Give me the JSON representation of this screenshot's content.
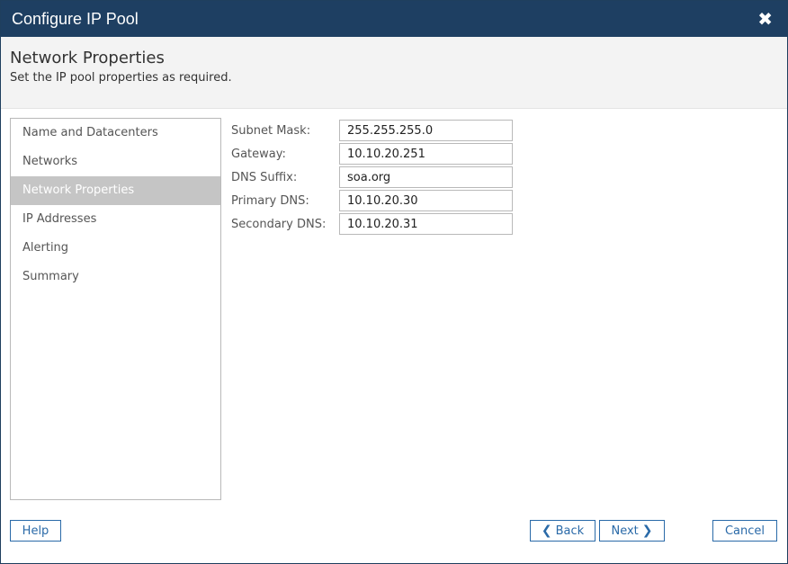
{
  "window": {
    "title": "Configure IP Pool",
    "close_icon": "✖"
  },
  "header": {
    "title": "Network Properties",
    "subtitle": "Set the IP pool properties as required."
  },
  "sidebar": {
    "items": [
      {
        "label": "Name and Datacenters",
        "active": false
      },
      {
        "label": "Networks",
        "active": false
      },
      {
        "label": "Network Properties",
        "active": true
      },
      {
        "label": "IP Addresses",
        "active": false
      },
      {
        "label": "Alerting",
        "active": false
      },
      {
        "label": "Summary",
        "active": false
      }
    ]
  },
  "form": {
    "subnet_mask": {
      "label": "Subnet Mask:",
      "value": "255.255.255.0"
    },
    "gateway": {
      "label": "Gateway:",
      "value": "10.10.20.251"
    },
    "dns_suffix": {
      "label": "DNS Suffix:",
      "value": "soa.org"
    },
    "primary_dns": {
      "label": "Primary DNS:",
      "value": "10.10.20.30"
    },
    "secondary_dns": {
      "label": "Secondary DNS:",
      "value": "10.10.20.31"
    }
  },
  "footer": {
    "help_label": "Help",
    "back_label": "Back",
    "next_label": "Next",
    "cancel_label": "Cancel",
    "back_icon": "❮",
    "next_icon": "❯"
  },
  "colors": {
    "titlebar": "#1e3f62",
    "accent": "#2a6aa8",
    "active_nav": "#c5c5c5"
  }
}
